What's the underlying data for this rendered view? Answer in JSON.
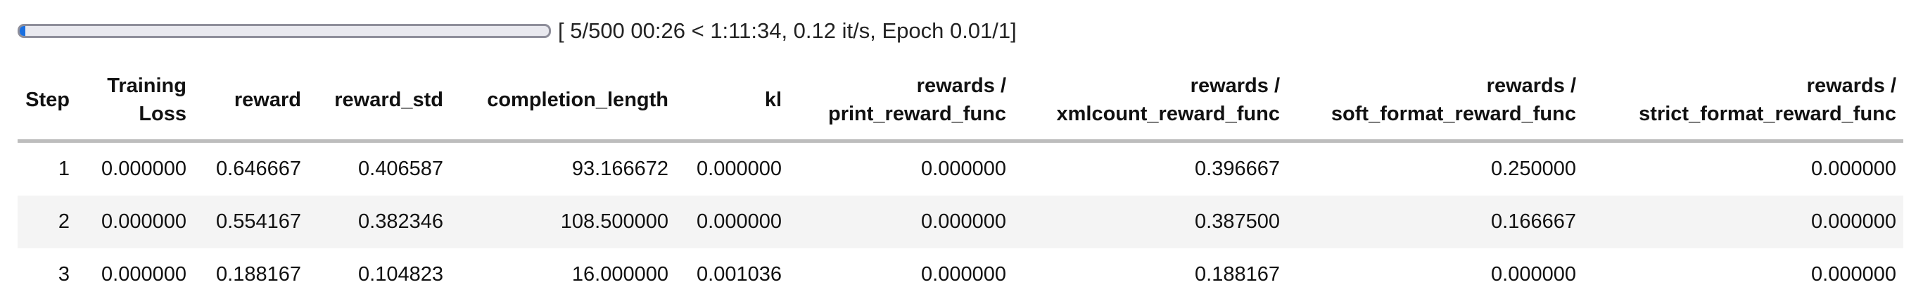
{
  "progress": {
    "text": "[ 5/500 00:26 < 1:11:34, 0.12 it/s, Epoch 0.01/1]",
    "fraction": 0.01,
    "color": "#1a6fe0"
  },
  "table": {
    "columns": [
      {
        "line1": "Step",
        "line2": ""
      },
      {
        "line1": "Training",
        "line2": "Loss"
      },
      {
        "line1": "reward",
        "line2": ""
      },
      {
        "line1": "reward_std",
        "line2": ""
      },
      {
        "line1": "completion_length",
        "line2": ""
      },
      {
        "line1": "kl",
        "line2": ""
      },
      {
        "line1": "rewards /",
        "line2": "print_reward_func"
      },
      {
        "line1": "rewards /",
        "line2": "xmlcount_reward_func"
      },
      {
        "line1": "rewards /",
        "line2": "soft_format_reward_func"
      },
      {
        "line1": "rewards /",
        "line2": "strict_format_reward_func"
      }
    ],
    "rows": [
      [
        "1",
        "0.000000",
        "0.646667",
        "0.406587",
        "93.166672",
        "0.000000",
        "0.000000",
        "0.396667",
        "0.250000",
        "0.000000"
      ],
      [
        "2",
        "0.000000",
        "0.554167",
        "0.382346",
        "108.500000",
        "0.000000",
        "0.000000",
        "0.387500",
        "0.166667",
        "0.000000"
      ],
      [
        "3",
        "0.000000",
        "0.188167",
        "0.104823",
        "16.000000",
        "0.001036",
        "0.000000",
        "0.188167",
        "0.000000",
        "0.000000"
      ]
    ]
  }
}
